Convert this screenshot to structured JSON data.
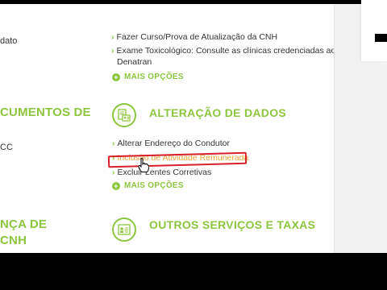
{
  "left_column": {
    "partial_top": "dato",
    "heading_documents": "CUMENTOS DE",
    "partial_cc": "CC",
    "heading_license_1": "NÇA DE",
    "heading_license_2": "CNH"
  },
  "section_top": {
    "items": [
      "Fazer Curso/Prova de Atualização da CNH",
      "Exame Toxicológico: Consulte as clínicas credenciadas ao",
      "Denatran"
    ],
    "more_label": "MAIS OPÇÕES"
  },
  "section_alteracao": {
    "title": "ALTERAÇÃO DE DADOS",
    "icon": "document-edit-icon",
    "items": [
      "Alterar Endereço do Condutor",
      "Inclusão de Atividade Remunerada",
      "Excluir Lentes Corretivas"
    ],
    "more_label": "MAIS OPÇÕES"
  },
  "section_outros": {
    "title": "OUTROS SERVIÇOS E TAXAS",
    "icon": "id-card-icon"
  },
  "colors": {
    "accent": "#8cc63e",
    "highlight_annotation": "#d81f2a",
    "hover_link": "#e8a33b"
  }
}
